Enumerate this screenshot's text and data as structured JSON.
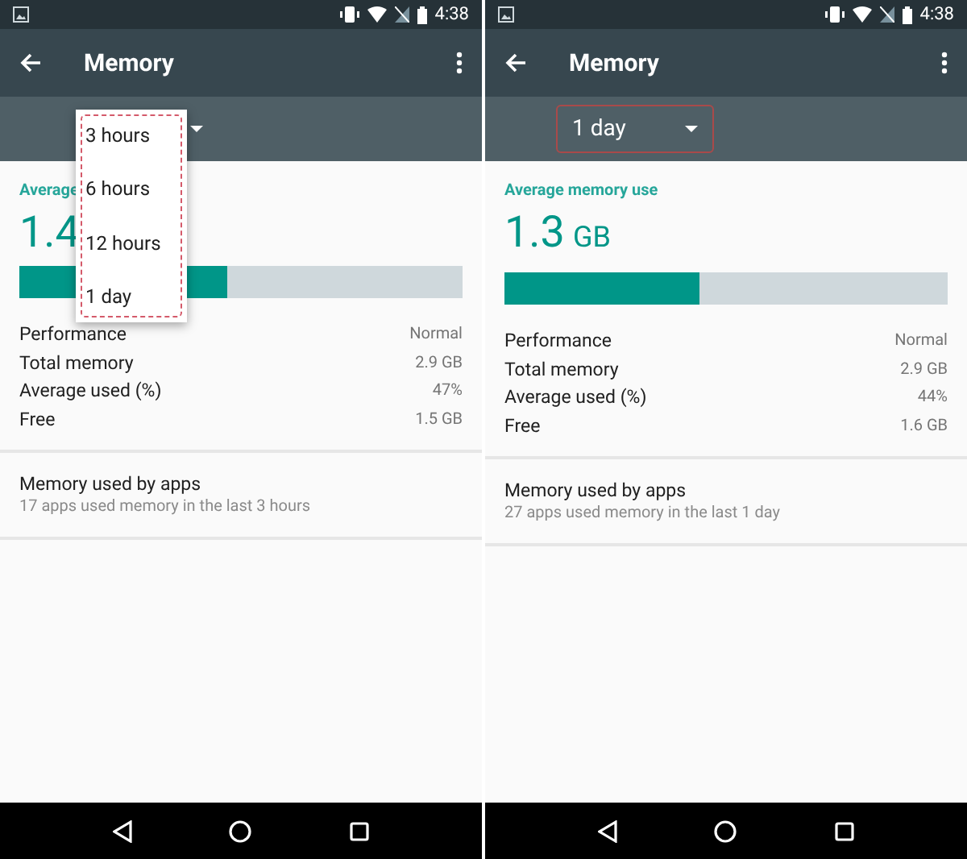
{
  "screens": [
    {
      "status_bar": {
        "time": "4:38"
      },
      "title": "Memory",
      "spinner": {
        "expanded": true,
        "options": [
          {
            "label": "3 hours"
          },
          {
            "label": "6 hours"
          },
          {
            "label": "12 hours"
          },
          {
            "label": "1 day"
          }
        ]
      },
      "summary": {
        "label": "Average",
        "value": "1.4",
        "level": 0.47
      },
      "stats": [
        {
          "label": "Performance",
          "value": "Normal"
        },
        {
          "label": "Total memory",
          "value": "2.9 GB"
        },
        {
          "label": "Average used (%)",
          "value": "47%"
        },
        {
          "label": "Free",
          "value": "1.5 GB"
        }
      ],
      "apps": {
        "title": "Memory used by apps",
        "subtitle": "17 apps used memory in the last 3 hours"
      }
    },
    {
      "status_bar": {
        "time": "4:38"
      },
      "title": "Memory",
      "spinner": {
        "expanded": false,
        "value": "1 day"
      },
      "summary": {
        "label": "Average memory use",
        "value": "1.3",
        "unit": "GB",
        "level": 0.44
      },
      "stats": [
        {
          "label": "Performance",
          "value": "Normal"
        },
        {
          "label": "Total memory",
          "value": "2.9 GB"
        },
        {
          "label": "Average used (%)",
          "value": "44%"
        },
        {
          "label": "Free",
          "value": "1.6 GB"
        }
      ],
      "apps": {
        "title": "Memory used by apps",
        "subtitle": "27 apps used memory in the last 1 day"
      }
    }
  ]
}
